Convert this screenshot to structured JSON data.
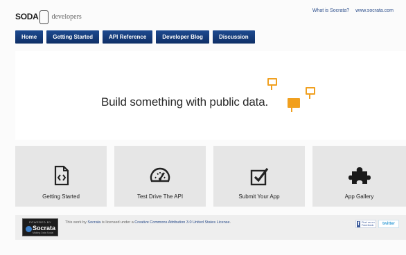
{
  "header": {
    "logo_text": "SODA",
    "logo_subtext": "developers",
    "links": [
      "What is Socrata?",
      "www.socrata.com"
    ]
  },
  "nav": {
    "items": [
      "Home",
      "Getting Started",
      "API Reference",
      "Developer Blog",
      "Discussion"
    ]
  },
  "hero": {
    "tagline": "Build something with public data.",
    "accent_color": "#f0a020"
  },
  "tiles": [
    {
      "label": "Getting Started",
      "icon": "document-code-icon"
    },
    {
      "label": "Test Drive The API",
      "icon": "speedometer-icon"
    },
    {
      "label": "Submit Your App",
      "icon": "checkbox-icon"
    },
    {
      "label": "App Gallery",
      "icon": "puzzle-piece-icon"
    }
  ],
  "footer": {
    "powered_by": "POWERED BY",
    "powered_name": "Socrata",
    "powered_sub": "Making Data Social",
    "license_pre": "This work by ",
    "license_author": "Socrata",
    "license_mid": " is licensed under a ",
    "license_link": "Creative Commons Attribution 3.0 United States License",
    "license_end": ".",
    "facebook_label": "Find us on Facebook",
    "facebook_letter": "f",
    "twitter_label": "twitter"
  },
  "colors": {
    "nav_bg": "#123a7a",
    "tile_bg": "#e6e6e6",
    "link": "#2a4c8a"
  }
}
